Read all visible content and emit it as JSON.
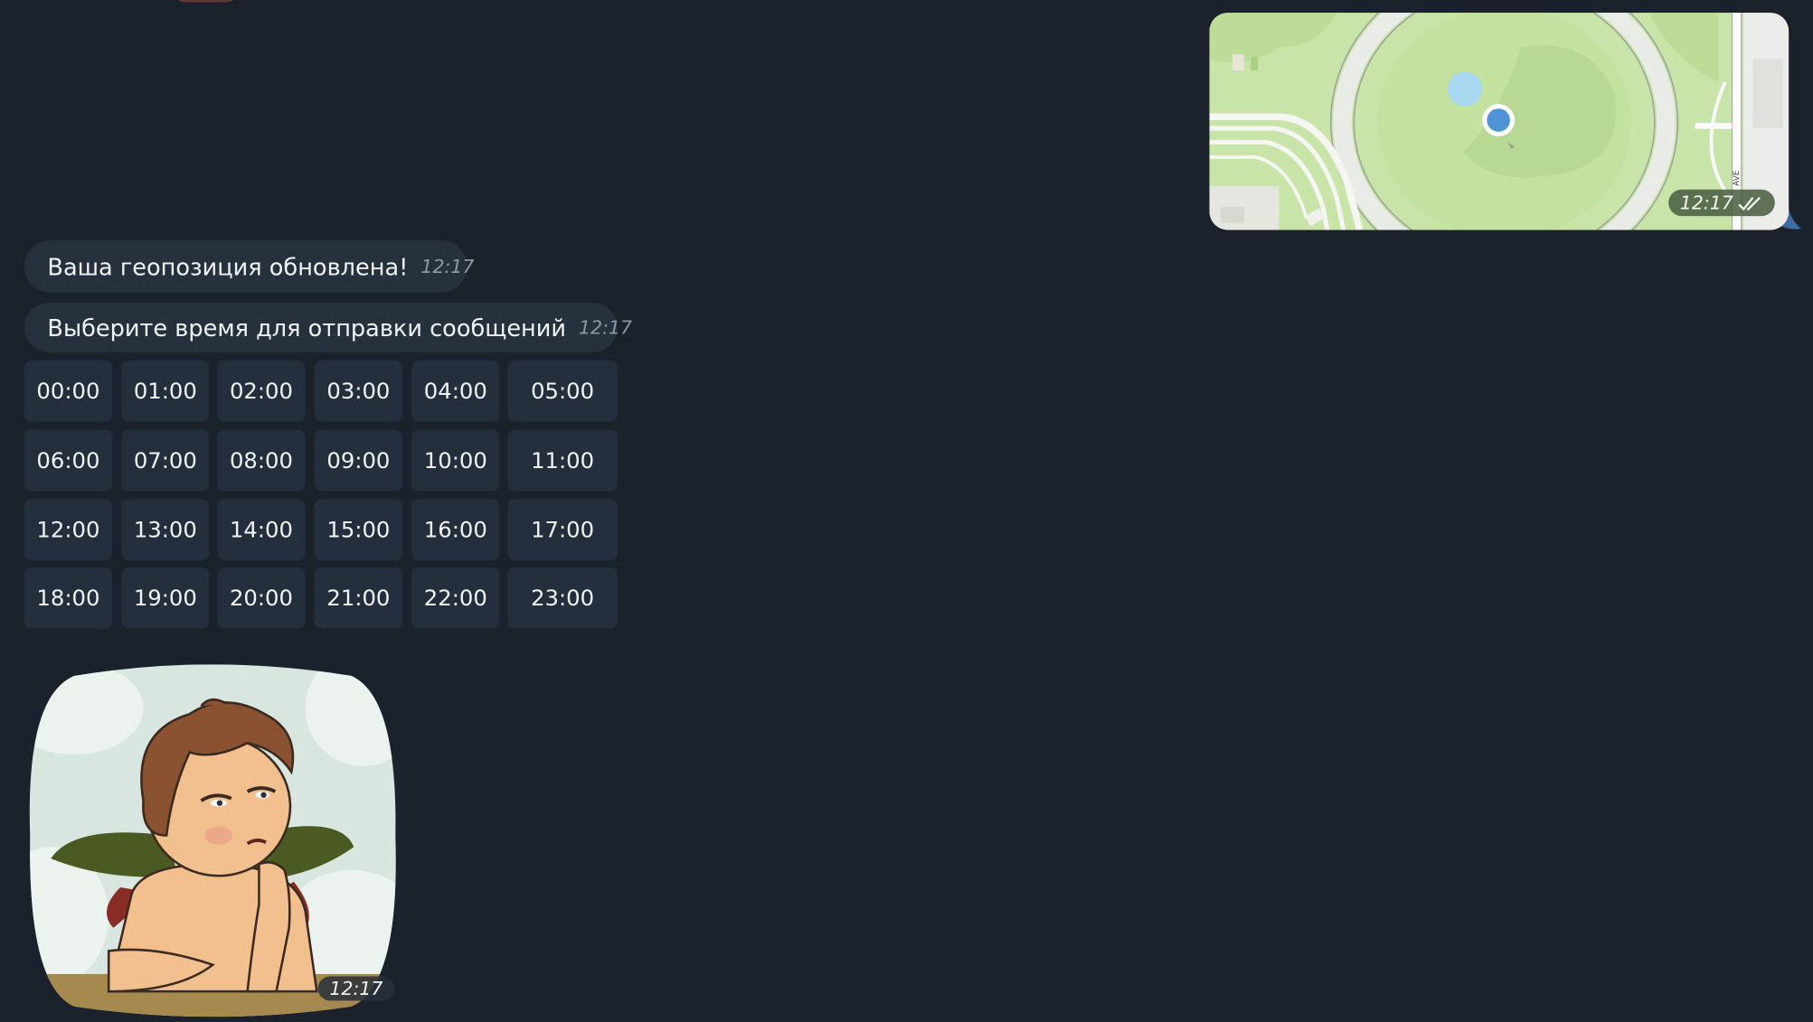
{
  "outgoing_location": {
    "time": "12:17",
    "street_label": "AVE",
    "status_icon": "double-check-icon"
  },
  "messages": [
    {
      "text": "Ваша геопозиция обновлена!",
      "time": "12:17"
    },
    {
      "text": "Выберите время для отправки сообщений",
      "time": "12:17"
    }
  ],
  "keyboard": {
    "rows": [
      [
        "00:00",
        "01:00",
        "02:00",
        "03:00",
        "04:00",
        "05:00"
      ],
      [
        "06:00",
        "07:00",
        "08:00",
        "09:00",
        "10:00",
        "11:00"
      ],
      [
        "12:00",
        "13:00",
        "14:00",
        "15:00",
        "16:00",
        "17:00"
      ],
      [
        "18:00",
        "19:00",
        "20:00",
        "21:00",
        "22:00",
        "23:00"
      ]
    ]
  },
  "sticker": {
    "time": "12:17",
    "description_icon": "cherub-sticker"
  },
  "colors": {
    "background": "#1b222c",
    "bubble": "#27303d",
    "keyboard_button": "#242e3c",
    "outgoing_accent": "#3e6aa0",
    "map_pin": "#4d93d6"
  }
}
